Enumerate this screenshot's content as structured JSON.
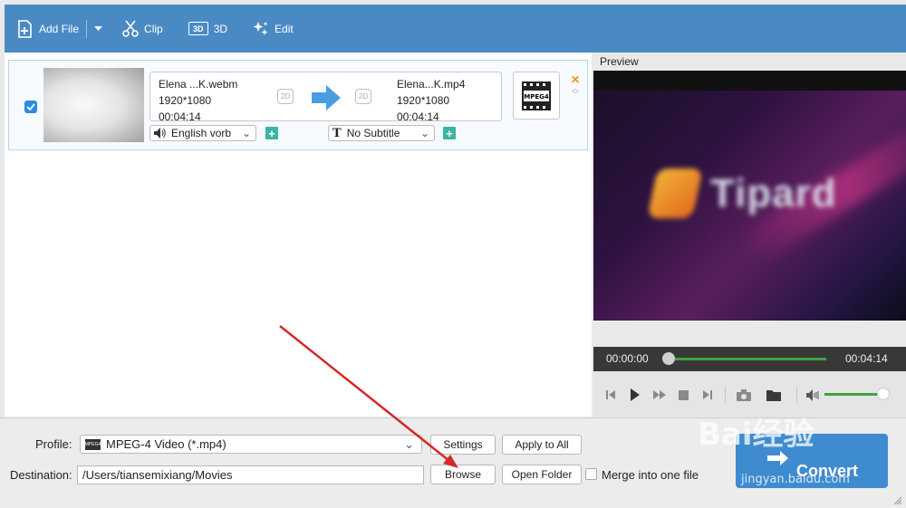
{
  "toolbar": {
    "add_file_label": "Add File",
    "clip_label": "Clip",
    "threed_label": "3D",
    "threed_badge": "3D",
    "edit_label": "Edit",
    "accent": "#4a8ac4"
  },
  "file": {
    "source_name": "Elena ...K.webm",
    "source_resolution": "1920*1080",
    "source_duration": "00:04:14",
    "target_name": "Elena...K.mp4",
    "target_resolution": "1920*1080",
    "target_duration": "00:04:14",
    "badge_2d": "2D",
    "format_icon_text": "MPEG4",
    "audio_track": "English vorb",
    "subtitle": "No Subtitle",
    "checked": true
  },
  "preview": {
    "title": "Preview",
    "time_current": "00:00:00",
    "time_total": "00:04:14",
    "progress": 0,
    "volume": 0.9,
    "logo_text": "Tipard"
  },
  "bottom": {
    "profile_label": "Profile:",
    "profile_value": "MPEG-4 Video (*.mp4)",
    "profile_icon_text": "MPEG4",
    "destination_label": "Destination:",
    "destination_value": "/Users/tiansemixiang/Movies",
    "settings_label": "Settings",
    "apply_all_label": "Apply to All",
    "browse_label": "Browse",
    "open_folder_label": "Open Folder",
    "merge_label": "Merge into one file",
    "convert_label": "Convert"
  },
  "watermark": {
    "brand": "Bai经验",
    "site": "jingyan.baidu.com"
  },
  "colors": {
    "annotation_arrow": "#d62828",
    "progress_green": "#3fa33f",
    "add_button": "#3cb4a4"
  }
}
